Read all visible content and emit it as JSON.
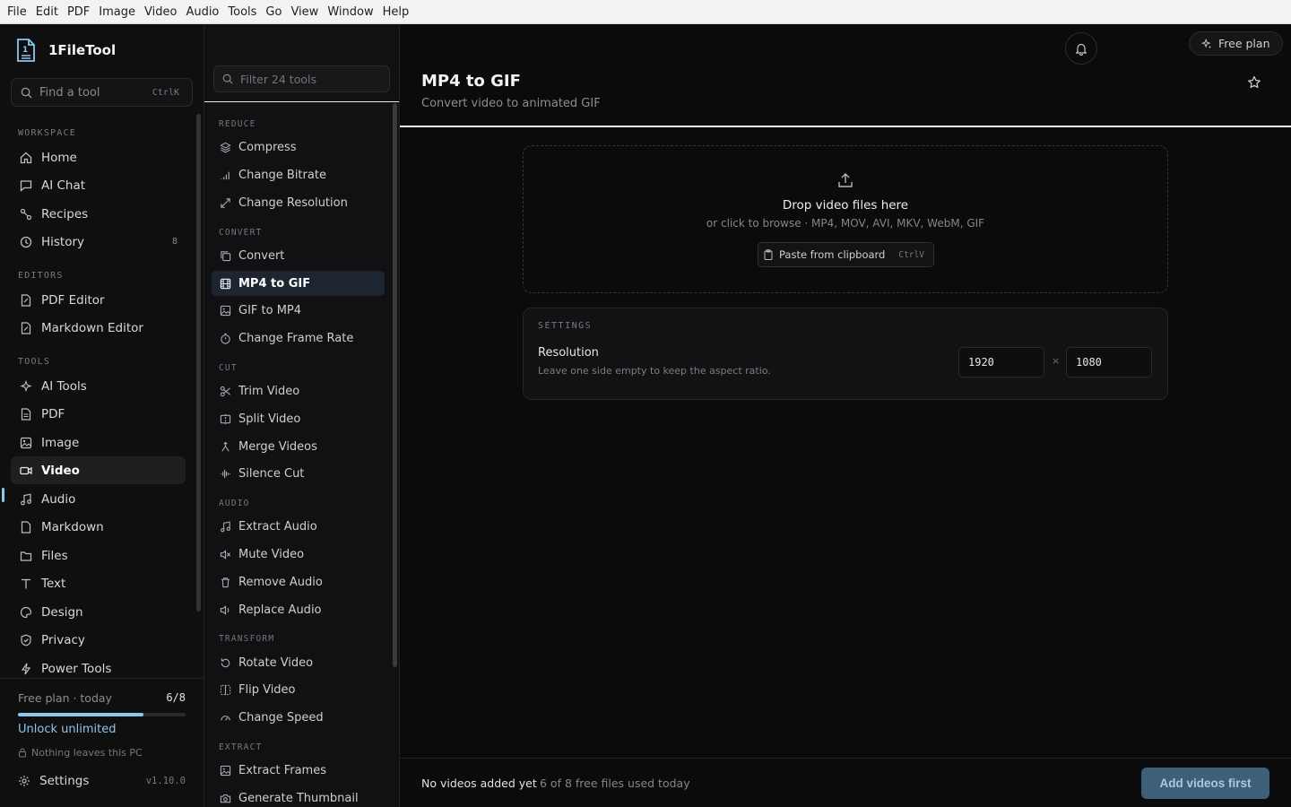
{
  "menubar": [
    "File",
    "Edit",
    "PDF",
    "Image",
    "Video",
    "Audio",
    "Tools",
    "Go",
    "View",
    "Window",
    "Help"
  ],
  "app": {
    "name": "1FileTool"
  },
  "search": {
    "placeholder": "Find a tool",
    "shortcut": "CtrlK"
  },
  "sidebar": {
    "sections": [
      {
        "label": "WORKSPACE",
        "items": [
          {
            "label": "Home",
            "icon": "home-icon"
          },
          {
            "label": "AI Chat",
            "icon": "chat-icon"
          },
          {
            "label": "Recipes",
            "icon": "recipes-icon"
          },
          {
            "label": "History",
            "icon": "history-icon",
            "count": "8"
          }
        ]
      },
      {
        "label": "EDITORS",
        "items": [
          {
            "label": "PDF Editor",
            "icon": "pdf-editor-icon"
          },
          {
            "label": "Markdown Editor",
            "icon": "markdown-editor-icon"
          }
        ]
      },
      {
        "label": "TOOLS",
        "items": [
          {
            "label": "AI Tools",
            "icon": "sparkles-icon"
          },
          {
            "label": "PDF",
            "icon": "document-icon"
          },
          {
            "label": "Image",
            "icon": "image-icon"
          },
          {
            "label": "Video",
            "icon": "video-icon",
            "active": true
          },
          {
            "label": "Audio",
            "icon": "music-icon"
          },
          {
            "label": "Markdown",
            "icon": "markdown-icon"
          },
          {
            "label": "Files",
            "icon": "folder-icon"
          },
          {
            "label": "Text",
            "icon": "text-icon"
          },
          {
            "label": "Design",
            "icon": "palette-icon"
          },
          {
            "label": "Privacy",
            "icon": "shield-icon"
          },
          {
            "label": "Power Tools",
            "icon": "bolt-icon"
          }
        ]
      }
    ]
  },
  "plan": {
    "label": "Free plan · today",
    "used_count": "6/8",
    "progress_fraction": 0.75,
    "unlock_label": "Unlock unlimited",
    "privacy_note": "Nothing leaves this PC"
  },
  "settings_link": {
    "label": "Settings",
    "version": "v1.10.0"
  },
  "tools_panel": {
    "filter_placeholder": "Filter 24 tools",
    "sections": [
      {
        "label": "REDUCE",
        "items": [
          "Compress",
          "Change Bitrate",
          "Change Resolution"
        ]
      },
      {
        "label": "CONVERT",
        "items": [
          "Convert",
          "MP4 to GIF",
          "GIF to MP4",
          "Change Frame Rate"
        ]
      },
      {
        "label": "CUT",
        "items": [
          "Trim Video",
          "Split Video",
          "Merge Videos",
          "Silence Cut"
        ]
      },
      {
        "label": "AUDIO",
        "items": [
          "Extract Audio",
          "Mute Video",
          "Remove Audio",
          "Replace Audio"
        ]
      },
      {
        "label": "TRANSFORM",
        "items": [
          "Rotate Video",
          "Flip Video",
          "Change Speed"
        ]
      },
      {
        "label": "EXTRACT",
        "items": [
          "Extract Frames",
          "Generate Thumbnail"
        ]
      }
    ],
    "active_item": "MP4 to GIF"
  },
  "header": {
    "free_plan_label": "Free plan"
  },
  "tool": {
    "title": "MP4 to GIF",
    "subtitle": "Convert video to animated GIF"
  },
  "dropzone": {
    "title": "Drop video files here",
    "subtitle": "or click to browse · MP4, MOV, AVI, MKV, WebM, GIF",
    "paste_label": "Paste from clipboard",
    "paste_shortcut": "CtrlV"
  },
  "settings_panel": {
    "heading": "SETTINGS",
    "resolution_label": "Resolution",
    "resolution_hint": "Leave one side empty to keep the aspect ratio.",
    "width": "1920",
    "height": "1080",
    "separator": "×"
  },
  "footer": {
    "status": "No videos added yet",
    "usage": "6 of 8 free files used today",
    "action_label": "Add videos first"
  },
  "colors": {
    "accent": "#8bc6ec",
    "button": "#3e5f78",
    "background": "#0b0b0c"
  }
}
